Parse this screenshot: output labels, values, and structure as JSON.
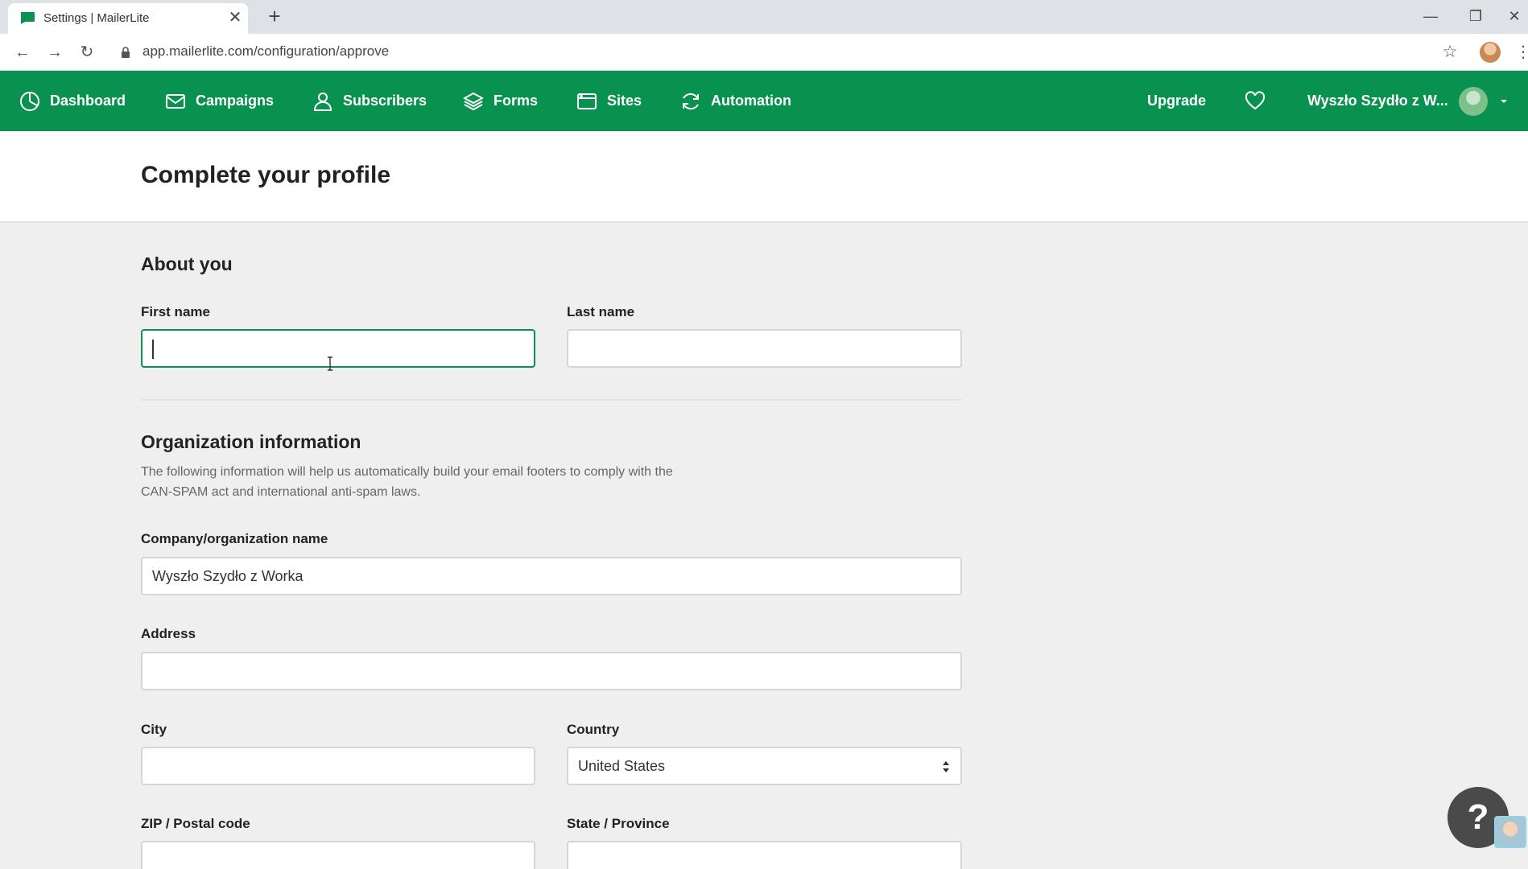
{
  "browser": {
    "tab_title": "Settings | MailerLite",
    "tab_close": "✕",
    "new_tab": "+",
    "minimize": "—",
    "restore": "❐",
    "close": "✕",
    "back": "←",
    "forward": "→",
    "reload": "↻",
    "url": "app.mailerlite.com/configuration/approve",
    "star": "☆",
    "menu": "⋮"
  },
  "nav": {
    "items": [
      {
        "label": "Dashboard",
        "icon": "dashboard-icon"
      },
      {
        "label": "Campaigns",
        "icon": "envelope-icon"
      },
      {
        "label": "Subscribers",
        "icon": "user-icon"
      },
      {
        "label": "Forms",
        "icon": "layers-icon"
      },
      {
        "label": "Sites",
        "icon": "browser-window-icon"
      },
      {
        "label": "Automation",
        "icon": "refresh-icon"
      }
    ],
    "upgrade": "Upgrade",
    "account_name": "Wyszło Szydło z W...",
    "brand_color": "#09914f"
  },
  "page": {
    "title": "Complete your profile"
  },
  "about": {
    "title": "About you",
    "first_name_label": "First name",
    "first_name_value": "",
    "last_name_label": "Last name",
    "last_name_value": ""
  },
  "org": {
    "title": "Organization information",
    "help_text": "The following information will help us automatically build your email footers to comply with the CAN-SPAM act and international anti-spam laws.",
    "company_label": "Company/organization name",
    "company_value": "Wyszło Szydło z Worka",
    "address_label": "Address",
    "address_value": "",
    "city_label": "City",
    "city_value": "",
    "country_label": "Country",
    "country_value": "United States",
    "zip_label": "ZIP / Postal code",
    "state_label": "State / Province"
  },
  "help_button": "?"
}
